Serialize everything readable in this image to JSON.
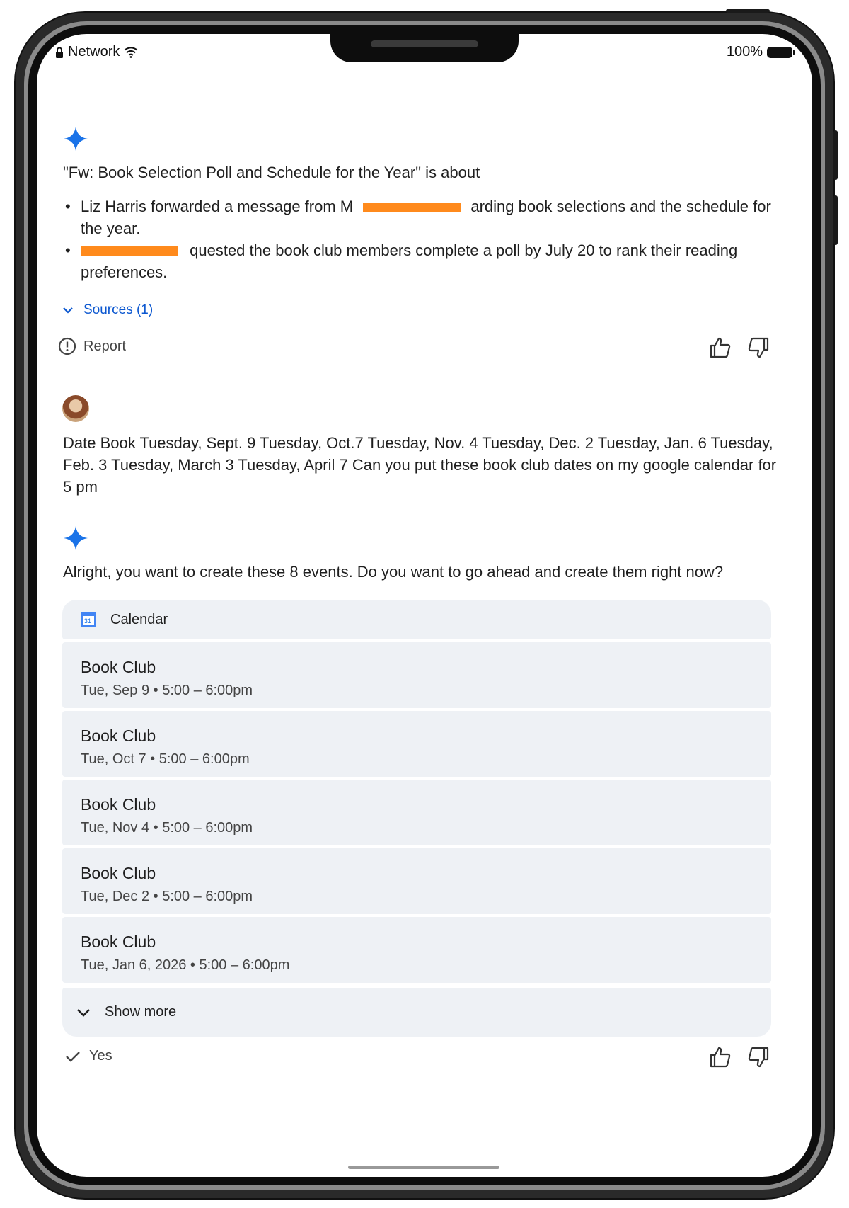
{
  "status_bar": {
    "network": "Network",
    "battery": "100%"
  },
  "summary": {
    "heading": "\"Fw: Book Selection Poll and Schedule for the Year\" is about",
    "bullet1_a": "Liz Harris forwarded a message from M",
    "bullet1_b": "arding book selections and the schedule for the year.",
    "bullet2_b": "quested the book club members complete a poll by July 20 to rank their reading preferences.",
    "sources_label": "Sources (1)",
    "report_label": "Report"
  },
  "user_message": "Date Book Tuesday, Sept. 9 Tuesday, Oct.7 Tuesday, Nov. 4 Tuesday, Dec. 2 Tuesday, Jan. 6 Tuesday, Feb. 3 Tuesday, March 3 Tuesday, April 7 Can you put these book club dates on my google calendar for 5 pm",
  "reply": {
    "text": "Alright, you want to create these 8 events. Do you want to go ahead and create them right now?",
    "card_title": "Calendar",
    "events": [
      {
        "title": "Book Club",
        "when": "Tue, Sep 9 • 5:00 – 6:00pm"
      },
      {
        "title": "Book Club",
        "when": "Tue, Oct 7 • 5:00 – 6:00pm"
      },
      {
        "title": "Book Club",
        "when": "Tue, Nov 4 • 5:00 – 6:00pm"
      },
      {
        "title": "Book Club",
        "when": "Tue, Dec 2 • 5:00 – 6:00pm"
      },
      {
        "title": "Book Club",
        "when": "Tue, Jan 6, 2026 • 5:00 – 6:00pm"
      }
    ],
    "show_more_label": "Show more",
    "yes_label": "Yes"
  },
  "colors": {
    "accent_blue": "#1a73e8",
    "card_bg": "#eef1f5",
    "redaction": "#ff8a1c"
  },
  "icons": [
    "lock-icon",
    "wifi-icon",
    "battery-icon",
    "gemini-sparkle-icon",
    "chevron-down-icon",
    "report-icon",
    "thumbs-up-icon",
    "thumbs-down-icon",
    "calendar-icon",
    "check-icon"
  ]
}
